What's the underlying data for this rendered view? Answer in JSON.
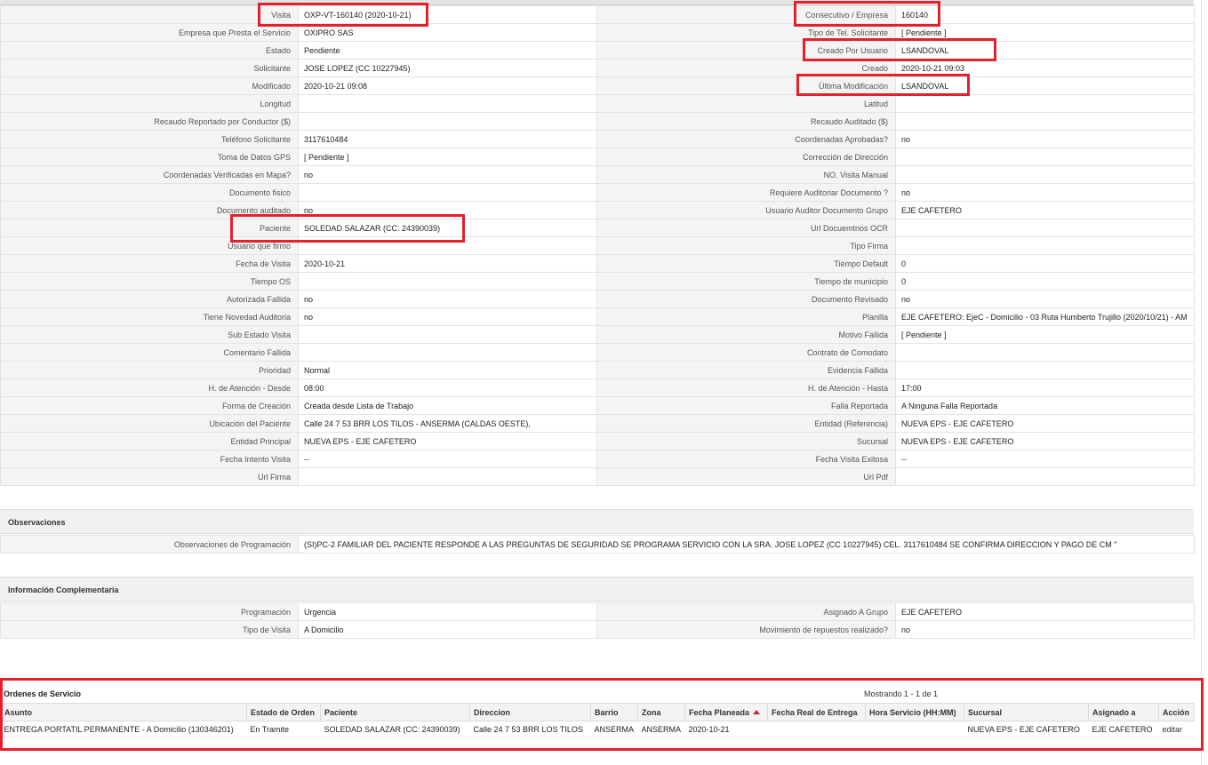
{
  "visit_details": [
    [
      "Visita",
      "OXP-VT-160140 (2020-10-21)",
      "Consecutivo / Empresa",
      "160140"
    ],
    [
      "Empresa que Presta el Servicio",
      "OXIPRO SAS",
      "Tipo de Tel. Solicitante",
      "[ Pendiente ]"
    ],
    [
      "Estado",
      "Pendiente",
      "Creado Por Usuario",
      "LSANDOVAL"
    ],
    [
      "Solicitante",
      "JOSE LOPEZ (CC 10227945)",
      "Creado",
      "2020-10-21 09:03"
    ],
    [
      "Modificado",
      "2020-10-21 09:08",
      "Última Modificación",
      "LSANDOVAL"
    ],
    [
      "Longitud",
      "",
      "Latitud",
      ""
    ],
    [
      "Recaudo Reportado por Conductor ($)",
      "",
      "Recaudo Auditado ($)",
      ""
    ],
    [
      "Teléfono Solicitante",
      "3117610484",
      "Coordenadas Aprobadas?",
      "no"
    ],
    [
      "Toma de Datos GPS",
      "[ Pendiente ]",
      "Corrección de Dirección",
      ""
    ],
    [
      "Coordenadas Verificadas en Mapa?",
      "no",
      "NO. Visita Manual",
      ""
    ],
    [
      "Documento fisico",
      "",
      "Requiere Auditoriar Documento ?",
      "no"
    ],
    [
      "Documento auditado",
      "no",
      "Usuario Auditor Documento Grupo",
      "EJE CAFETERO"
    ],
    [
      "Paciente",
      "SOLEDAD SALAZAR (CC: 24390039)",
      "Url Docuemtnos OCR",
      ""
    ],
    [
      "Usuario que firmo",
      "",
      "Tipo Firma",
      ""
    ],
    [
      "Fecha de Visita",
      "2020-10-21",
      "Tiempo Default",
      "0"
    ],
    [
      "Tiempo OS",
      "",
      "Tiempo de municipio",
      "0"
    ],
    [
      "Autorizada Fallida",
      "no",
      "Documento Revisado",
      "no"
    ],
    [
      "Tiene Novedad Auditoria",
      "no",
      "Planilla",
      "EJE CAFETERO: EjeC - Domicilio - 03 Ruta Humberto Trujillo (2020/10/21) - AM"
    ],
    [
      "Sub Estado Visita",
      "",
      "Motivo Fallida",
      "[ Pendiente ]"
    ],
    [
      "Comentario Fallida",
      "",
      "Contrato de Comodato",
      ""
    ],
    [
      "Prioridad",
      "Normal",
      "Evidencia Fallida",
      ""
    ],
    [
      "H. de Atención - Desde",
      "08:00",
      "H. de Atención - Hasta",
      "17:00"
    ],
    [
      "Forma de Creación",
      "Creada desde Lista de Trabajo",
      "Falla Reportada",
      "A Ninguna Falla Reportada"
    ],
    [
      "Ubicación del Paciente",
      "Calle 24 7 53 BRR LOS TILOS - ANSERMA (CALDAS OESTE),",
      "Entidad (Referencia)",
      "NUEVA EPS - EJE CAFETERO"
    ],
    [
      "Entidad Principal",
      "NUEVA EPS - EJE CAFETERO",
      "Sucursal",
      "NUEVA EPS - EJE CAFETERO"
    ],
    [
      "Fecha Intento Visita",
      "--",
      "Fecha Visita Exitosa",
      "--"
    ],
    [
      "Url Firma",
      "",
      "Url Pdf",
      ""
    ]
  ],
  "observaciones": {
    "title": "Observaciones",
    "label": "Observaciones de Programación",
    "value": "(SI)PC-2 FAMILIAR DEL PACIENTE RESPONDE A LAS PREGUNTAS DE SEGURIDAD SE PROGRAMA SERVICIO CON LA SRA. JOSE LOPEZ (CC 10227945) CEL. 3117610484 SE CONFIRMA DIRECCION Y PAGO DE CM \""
  },
  "info_complementaria": {
    "title": "Información Complementaria",
    "rows": [
      [
        "Programación",
        "Urgencia",
        "Asignado A Grupo",
        "EJE CAFETERO"
      ],
      [
        "Tipo de Visita",
        "A Domicilio",
        "Movimiento de repuestos realizado?",
        "no"
      ]
    ]
  },
  "ordenes": {
    "title": "Ordenes de Servicio",
    "count_text": "Mostrando 1 - 1 de 1",
    "columns": [
      "Asunto",
      "Estado de Orden",
      "Paciente",
      "Direccion",
      "Barrio",
      "Zona",
      "Fecha Planeada",
      "Fecha Real de Entrega",
      "Hora Servicio (HH:MM)",
      "Sucursal",
      "Asignado a",
      "Acción"
    ],
    "rows": [
      [
        "ENTREGA PORTATIL PERMANENTE - A Domicilio (130346201)",
        "En Tramite",
        "SOLEDAD SALAZAR (CC: 24390039)",
        "Calle 24 7 53 BRR LOS TILOS",
        "ANSERMA",
        "ANSERMA",
        "2020-10-21",
        "",
        "",
        "NUEVA EPS - EJE CAFETERO",
        "EJE CAFETERO",
        "editar"
      ]
    ]
  },
  "colors": {
    "highlight_border": "#e5202d",
    "sort_indicator": "#c0282d"
  }
}
